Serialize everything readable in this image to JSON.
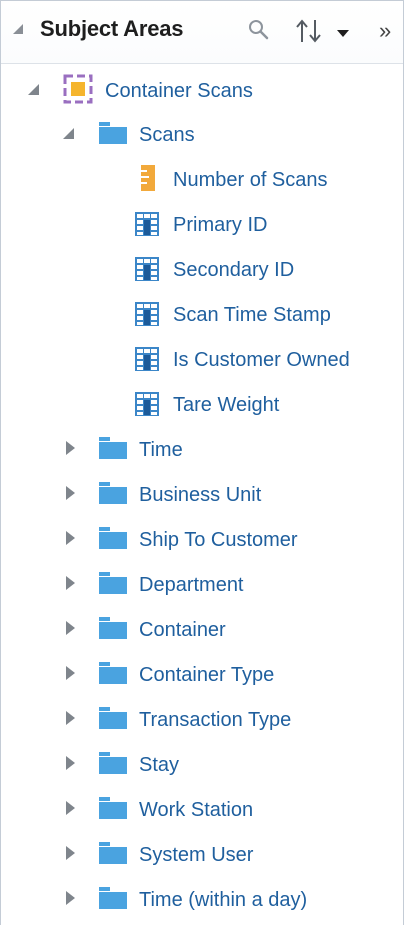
{
  "header": {
    "title": "Subject Areas",
    "more_label": "»"
  },
  "colors": {
    "link_text": "#1f5f9e",
    "folder": "#4aa3e0",
    "measure": "#f2a93b",
    "column": "#3b86c8",
    "subject_area": "#9a6fc0"
  },
  "tree": {
    "root": {
      "label": "Container Scans",
      "icon": "subject-area-icon",
      "expanded": true
    },
    "scans": {
      "label": "Scans",
      "icon": "folder-icon",
      "expanded": true
    },
    "scans_children": [
      {
        "label": "Number of Scans",
        "icon": "measure-icon"
      },
      {
        "label": "Primary ID",
        "icon": "column-icon"
      },
      {
        "label": "Secondary ID",
        "icon": "column-icon"
      },
      {
        "label": "Scan Time Stamp",
        "icon": "column-icon"
      },
      {
        "label": "Is Customer Owned",
        "icon": "column-icon"
      },
      {
        "label": "Tare Weight",
        "icon": "column-icon"
      }
    ],
    "folders": [
      {
        "label": "Time"
      },
      {
        "label": "Business Unit"
      },
      {
        "label": "Ship To Customer"
      },
      {
        "label": "Department"
      },
      {
        "label": "Container"
      },
      {
        "label": "Container Type"
      },
      {
        "label": "Transaction Type"
      },
      {
        "label": "Stay"
      },
      {
        "label": "Work Station"
      },
      {
        "label": "System User"
      },
      {
        "label": "Time (within a day)"
      }
    ]
  }
}
